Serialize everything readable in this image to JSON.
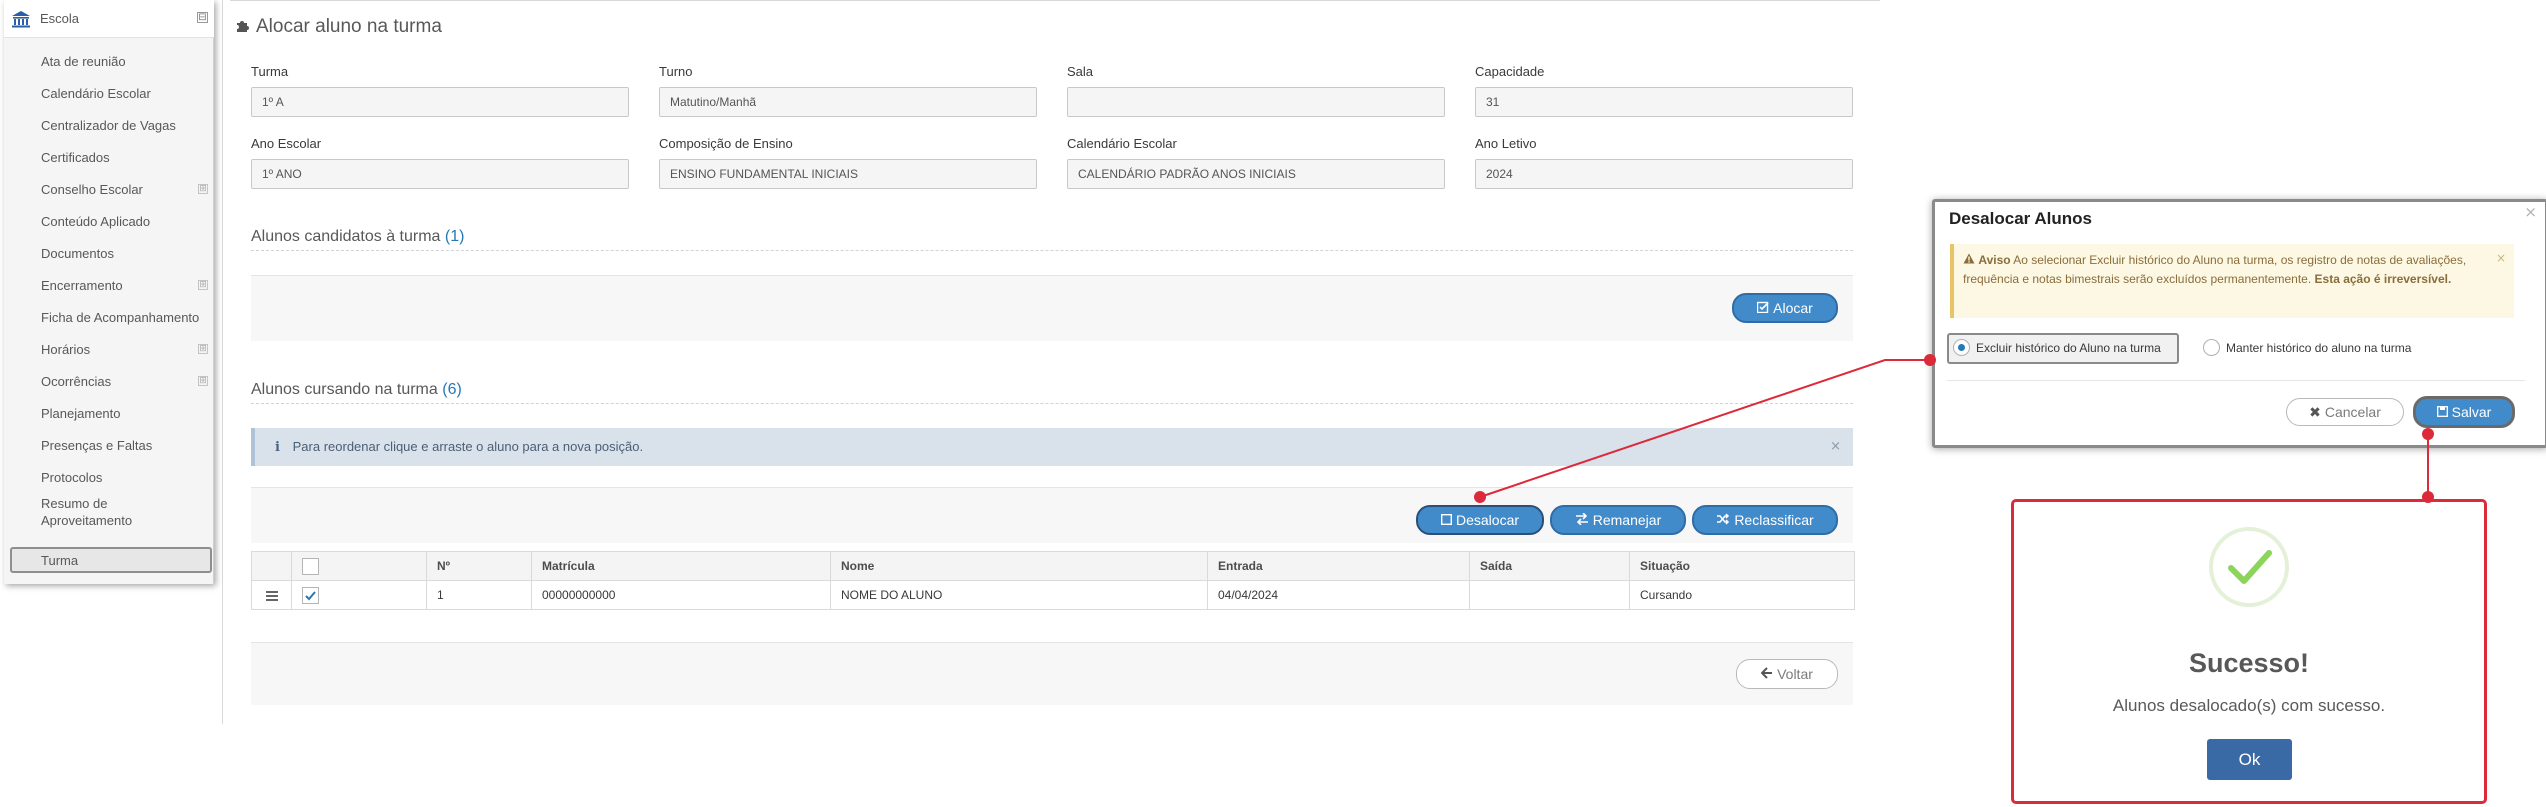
{
  "sidebar": {
    "top_label": "Escola",
    "items": [
      {
        "label": "Ata de reunião",
        "expand": false
      },
      {
        "label": "Calendário Escolar",
        "expand": false
      },
      {
        "label": "Centralizador de Vagas",
        "expand": false
      },
      {
        "label": "Certificados",
        "expand": false
      },
      {
        "label": "Conselho Escolar",
        "expand": true
      },
      {
        "label": "Conteúdo Aplicado",
        "expand": false
      },
      {
        "label": "Documentos",
        "expand": false
      },
      {
        "label": "Encerramento",
        "expand": true
      },
      {
        "label": "Ficha de Acompanhamento",
        "expand": false
      },
      {
        "label": "Horários",
        "expand": true
      },
      {
        "label": "Ocorrências",
        "expand": true
      },
      {
        "label": "Planejamento",
        "expand": false
      },
      {
        "label": "Presenças e Faltas",
        "expand": false
      },
      {
        "label": "Protocolos",
        "expand": false
      },
      {
        "label": "Resumo de Aproveitamento",
        "expand": false
      },
      {
        "label": "Turma",
        "expand": false,
        "active": true
      }
    ],
    "toggle_glyph": "⊟",
    "expand_glyph": "⊞"
  },
  "page": {
    "title": "Alocar aluno na turma",
    "fields": {
      "turma": {
        "label": "Turma",
        "value": "1º A"
      },
      "turno": {
        "label": "Turno",
        "value": "Matutino/Manhã"
      },
      "sala": {
        "label": "Sala",
        "value": ""
      },
      "capacidade": {
        "label": "Capacidade",
        "value": "31"
      },
      "ano_escolar": {
        "label": "Ano Escolar",
        "value": "1º ANO"
      },
      "composicao": {
        "label": "Composição de Ensino",
        "value": "ENSINO FUNDAMENTAL INICIAIS"
      },
      "calendario": {
        "label": "Calendário Escolar",
        "value": "CALENDÁRIO PADRÃO ANOS INICIAIS"
      },
      "ano_letivo": {
        "label": "Ano Letivo",
        "value": "2024"
      }
    },
    "candidatos": {
      "title": "Alunos candidatos à turma",
      "count": "(1)"
    },
    "alocar_label": "Alocar",
    "cursando": {
      "title": "Alunos cursando na turma",
      "count": "(6)"
    },
    "info": {
      "text": "Para reordenar clique e arraste o aluno para a nova posição.",
      "close": "×"
    },
    "buttons": {
      "desalocar": "Desalocar",
      "remanejar": "Remanejar",
      "reclassificar": "Reclassificar",
      "voltar": "Voltar"
    },
    "table": {
      "columns": [
        "Nº",
        "Matrícula",
        "Nome",
        "Entrada",
        "Saída",
        "Situação"
      ],
      "rows": [
        {
          "numero": "1",
          "matricula": "00000000000",
          "nome": "NOME DO ALUNO",
          "entrada": "04/04/2024",
          "saida": "",
          "situacao": "Cursando",
          "checked": true
        }
      ]
    }
  },
  "dialog": {
    "title": "Desalocar Alunos",
    "close": "×",
    "warning": {
      "bold": "Aviso",
      "text": " Ao selecionar Excluir histórico do Aluno na turma, os registro de notas de avaliações, frequência e notas bimestrais serão excluídos permanentemente. ",
      "emphasis": "Esta ação é irreversível.",
      "close": "×"
    },
    "options": {
      "excluir": "Excluir histórico do Aluno na turma",
      "manter": "Manter histórico do aluno na turma",
      "selected": "excluir"
    },
    "cancel_label": "Cancelar",
    "save_label": "Salvar"
  },
  "success": {
    "title": "Sucesso!",
    "message": "Alunos desalocado(s) com sucesso.",
    "ok_label": "Ok"
  },
  "colors": {
    "primary": "#428bca",
    "annotation_red": "#dc2a3a",
    "check_green": "#8cd45a"
  }
}
